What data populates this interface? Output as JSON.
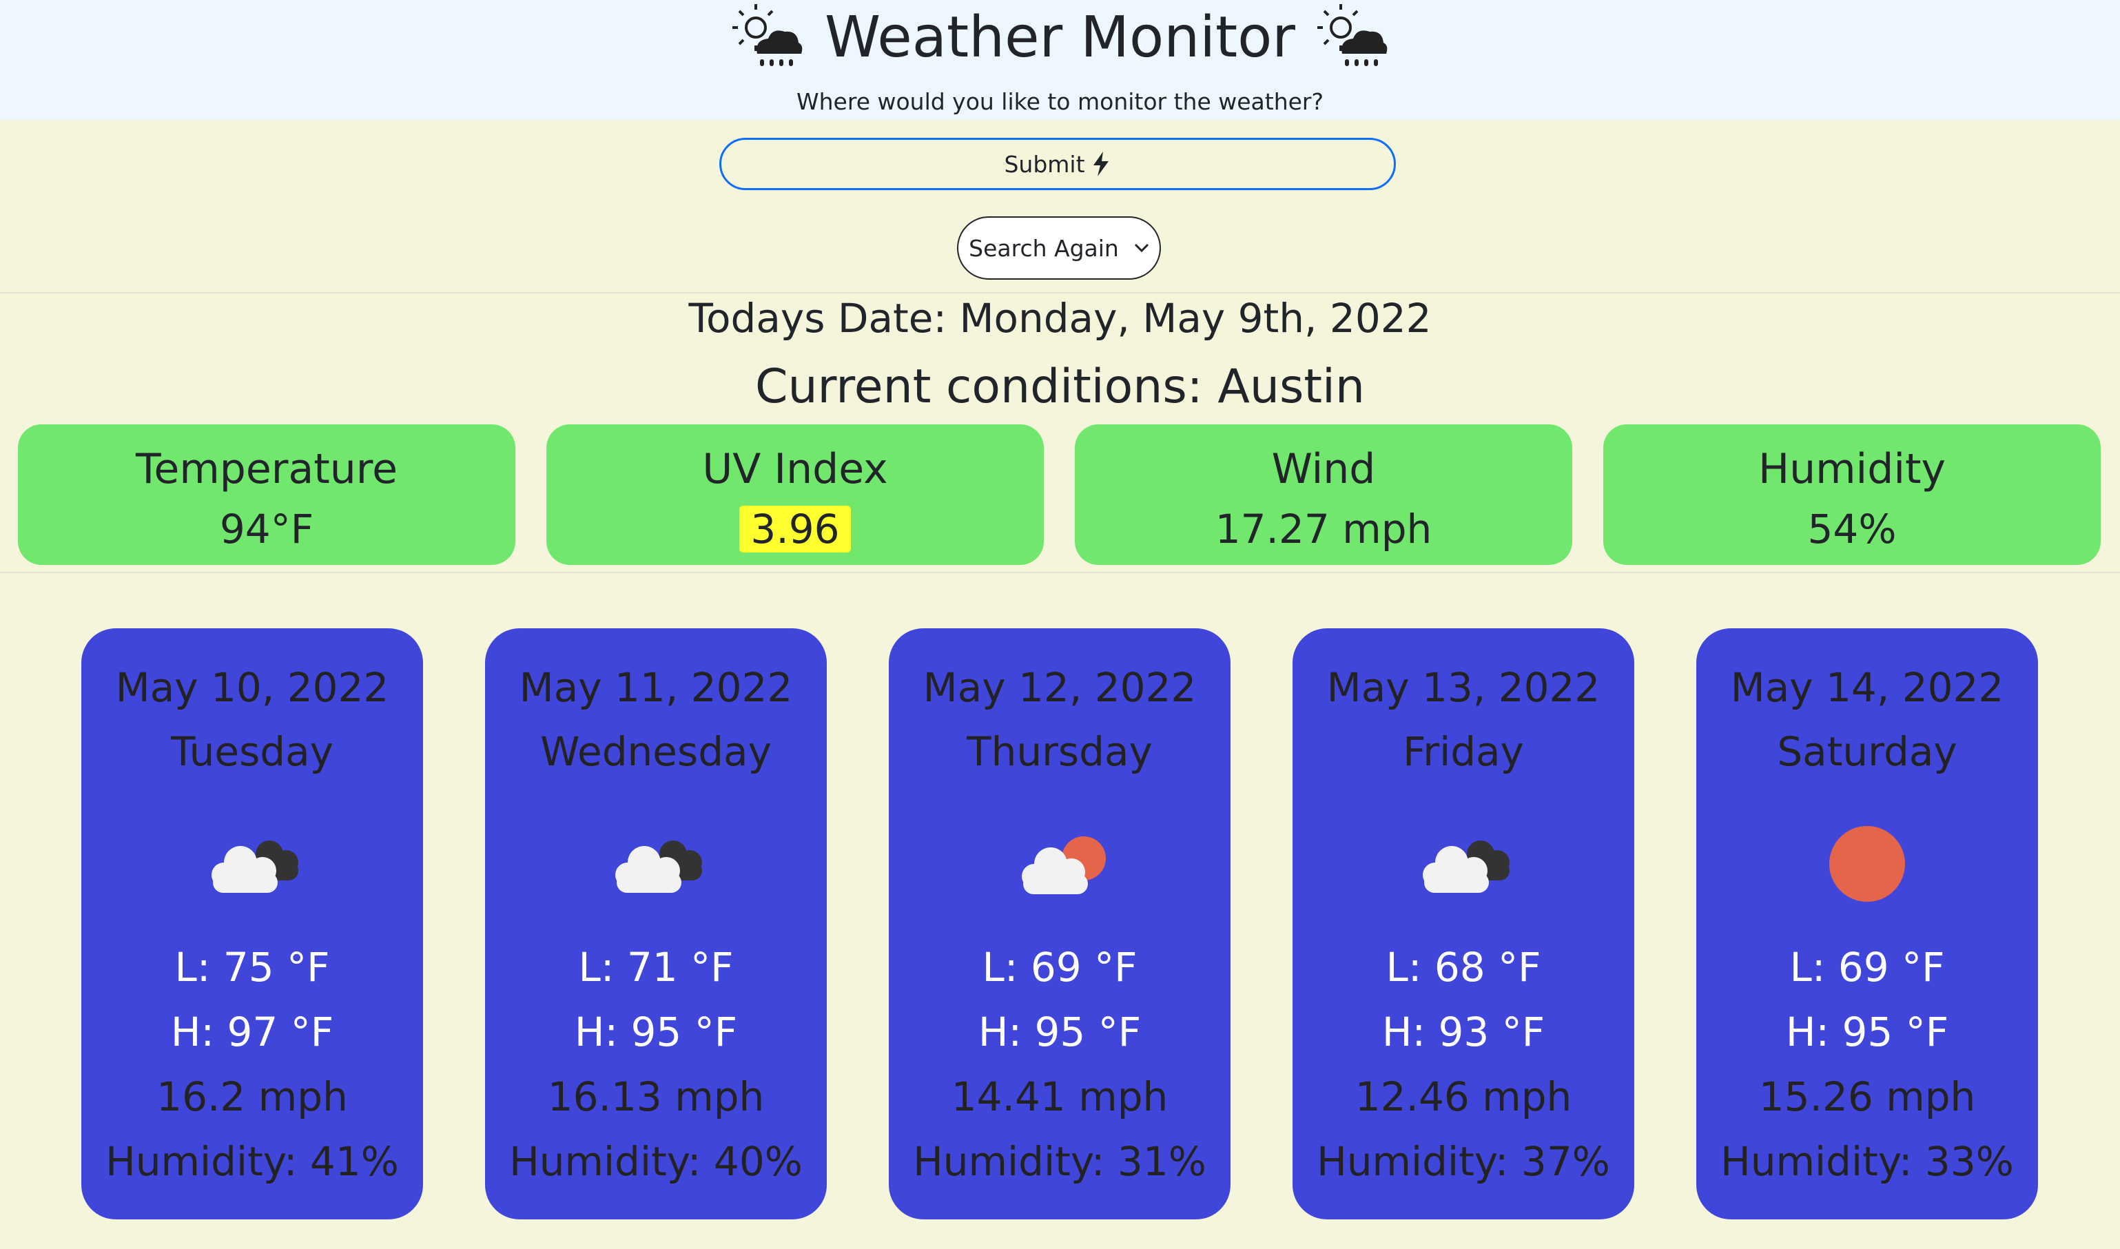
{
  "header": {
    "title": "Weather Monitor",
    "subtitle": "Where would you like to monitor the weather?",
    "title_icon": "sun-behind-rain-cloud-icon"
  },
  "search": {
    "submit_label": "Submit",
    "submit_icon": "lightning-bolt-icon",
    "history_select_value": "Search Again"
  },
  "today": {
    "date_text": "Todays Date: Monday, May 9th, 2022",
    "conditions_text": "Current conditions: Austin"
  },
  "current": [
    {
      "label": "Temperature",
      "value": "94°F"
    },
    {
      "label": "UV Index",
      "value": "3.96"
    },
    {
      "label": "Wind",
      "value": "17.27 mph"
    },
    {
      "label": "Humidity",
      "value": "54%"
    }
  ],
  "forecast": [
    {
      "date": "May 10, 2022",
      "day": "Tuesday",
      "icon": "broken-clouds-icon",
      "low": "L: 75 °F",
      "high": "H: 97 °F",
      "wind": "16.2 mph",
      "humidity": "Humidity: 41%"
    },
    {
      "date": "May 11, 2022",
      "day": "Wednesday",
      "icon": "broken-clouds-icon",
      "low": "L: 71 °F",
      "high": "H: 95 °F",
      "wind": "16.13 mph",
      "humidity": "Humidity: 40%"
    },
    {
      "date": "May 12, 2022",
      "day": "Thursday",
      "icon": "few-clouds-icon",
      "low": "L: 69 °F",
      "high": "H: 95 °F",
      "wind": "14.41 mph",
      "humidity": "Humidity: 31%"
    },
    {
      "date": "May 13, 2022",
      "day": "Friday",
      "icon": "broken-clouds-icon",
      "low": "L: 68 °F",
      "high": "H: 93 °F",
      "wind": "12.46 mph",
      "humidity": "Humidity: 37%"
    },
    {
      "date": "May 14, 2022",
      "day": "Saturday",
      "icon": "clear-sun-icon",
      "low": "L: 69 °F",
      "high": "H: 95 °F",
      "wind": "15.26 mph",
      "humidity": "Humidity: 33%"
    }
  ],
  "colors": {
    "page_bg": "#f5f5dc",
    "header_bg": "#eef6ff",
    "current_card": "#72e76e",
    "forecast_card": "#4046da",
    "uv_highlight": "#ffff2e",
    "submit_border": "#0d6efd",
    "sun": "#e5654b"
  }
}
